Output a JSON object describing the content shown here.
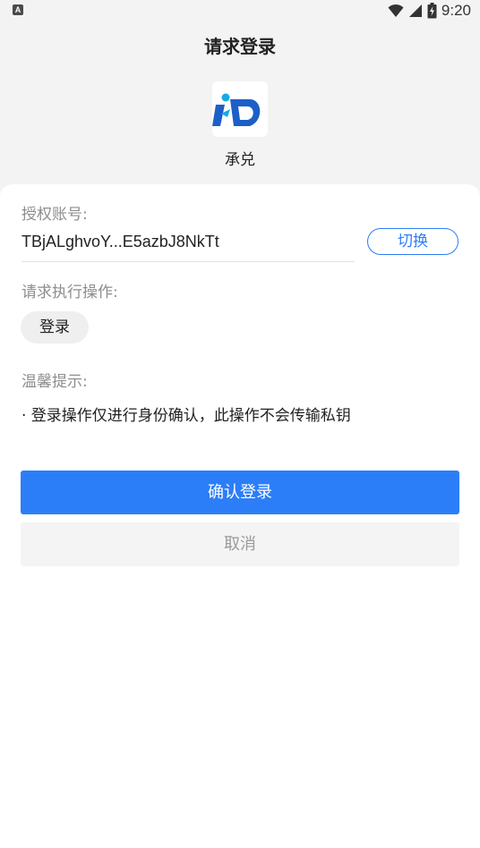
{
  "status_bar": {
    "notification_icon": "A",
    "time": "9:20",
    "icons": [
      "wifi-icon",
      "cell-signal-icon",
      "battery-icon"
    ]
  },
  "header": {
    "title": "请求登录"
  },
  "app": {
    "name": "承兑",
    "logo_icon": "app-logo-icon"
  },
  "account": {
    "label": "授权账号:",
    "value": "TBjALghvoY...E5azbJ8NkTt",
    "switch_label": "切换"
  },
  "request": {
    "label": "请求执行操作:",
    "action": "登录"
  },
  "tips": {
    "label": "温馨提示:",
    "text": "· 登录操作仅进行身份确认，此操作不会传输私钥"
  },
  "buttons": {
    "confirm": "确认登录",
    "cancel": "取消"
  },
  "colors": {
    "accent": "#2c7ef8",
    "background": "#f3f3f4"
  }
}
